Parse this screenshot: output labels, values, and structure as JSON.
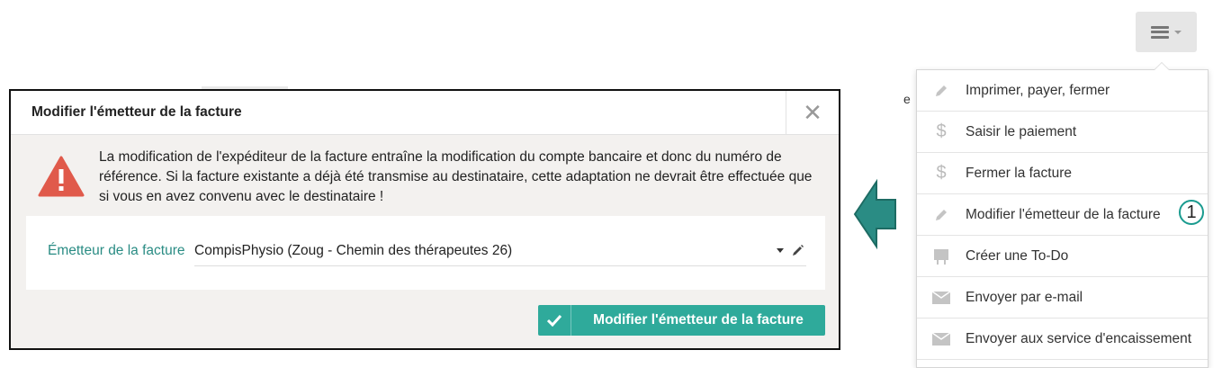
{
  "toolbar": {
    "menu_icon": "hamburger-icon"
  },
  "dropdown": {
    "items": [
      {
        "label": "Imprimer, payer, fermer",
        "icon": "pencil-icon"
      },
      {
        "label": "Saisir le paiement",
        "icon": "dollar-icon"
      },
      {
        "label": "Fermer la facture",
        "icon": "dollar-icon"
      },
      {
        "label": "Modifier l'émetteur de la facture",
        "icon": "pencil-icon"
      },
      {
        "label": "Créer une To-Do",
        "icon": "easel-icon"
      },
      {
        "label": "Envoyer par e-mail",
        "icon": "envelope-icon"
      },
      {
        "label": "Envoyer aux service d'encaissement",
        "icon": "envelope-icon"
      }
    ],
    "badge": "1"
  },
  "modal": {
    "title": "Modifier l'émetteur de la facture",
    "warning": "La modification de l'expéditeur de la facture entraîne la modification du compte bancaire et donc du numéro de référence. Si la facture existante a déjà été transmise au destinataire, cette adaptation ne devrait être effectuée que si vous en avez convenu avec le destinataire !",
    "field_label": "Émetteur de la facture",
    "field_value": "CompisPhysio (Zoug - Chemin des thérapeutes 26)",
    "submit_label": "Modifier l'émetteur de la facture"
  },
  "colors": {
    "accent": "#2faa9b",
    "warning": "#e05a4b",
    "label": "#2a8c84"
  }
}
